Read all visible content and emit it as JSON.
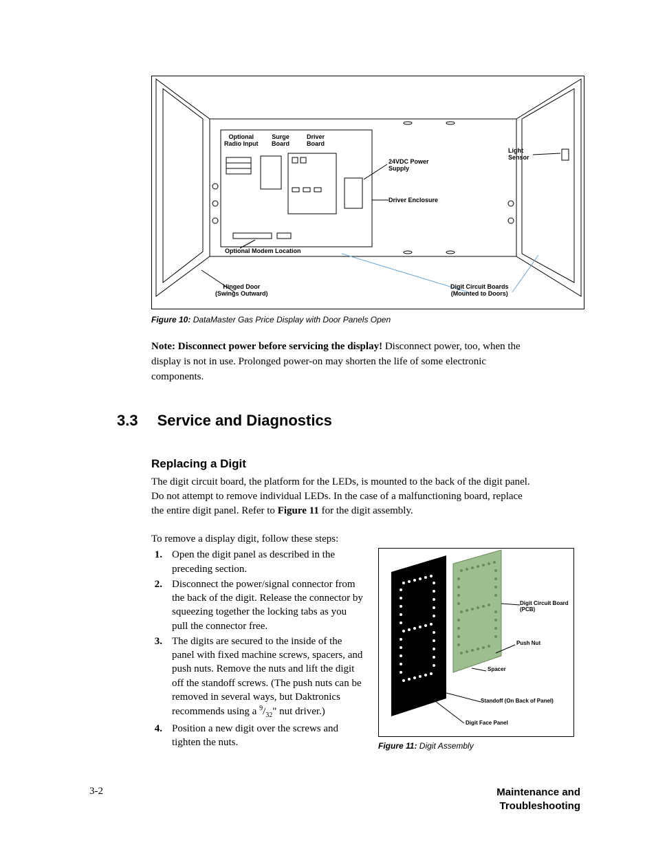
{
  "figure10": {
    "caption_bold": "Figure 10:",
    "caption_text": " DataMaster Gas Price Display with Door Panels Open",
    "labels": {
      "optional_radio_input": "Optional\nRadio Input",
      "surge_board": "Surge\nBoard",
      "driver_board": "Driver\nBoard",
      "power_supply": "24VDC Power\nSupply",
      "driver_enclosure": "Driver Enclosure",
      "light_sensor": "Light\nSensor",
      "optional_modem": "Optional Modem Location",
      "hinged_door": "Hinged Door\n(Swings Outward)",
      "digit_boards": "Digit Circuit Boards\n(Mounted to Doors)"
    }
  },
  "note": {
    "bold": "Note: Disconnect power before servicing the display!",
    "text": " Disconnect power, too, when the display is not in use. Prolonged power-on may shorten the life of some electronic components."
  },
  "section": {
    "number": "3.3",
    "title": "Service and Diagnostics"
  },
  "subsection": {
    "title": "Replacing a Digit",
    "para": "The digit circuit board, the platform for the LEDs, is mounted to the back of the digit panel. Do not attempt to remove individual LEDs. In the case of a malfunctioning board, replace the entire digit panel. Refer to ",
    "para_figref": "Figure 11",
    "para_tail": " for the digit assembly.",
    "intro": "To remove a display digit, follow these steps:"
  },
  "steps": [
    {
      "n": "1.",
      "t": "Open the digit panel as described in the preceding section."
    },
    {
      "n": "2.",
      "t": "Disconnect the power/signal connector from the back of the digit. Release the connector by squeezing together the locking tabs as you pull the connector free."
    },
    {
      "n": "3.",
      "t": "The digits are secured to the inside of the panel with fixed machine screws, spacers, and push nuts. Remove the nuts and lift the digit off the standoff screws. (The push nuts can be removed in several ways, but Daktronics recommends using a ",
      "frac_n": "9",
      "frac_d": "32",
      "tail": "\" nut driver.)"
    },
    {
      "n": "4.",
      "t": "Position a new digit over the screws and tighten the nuts."
    }
  ],
  "figure11": {
    "caption_bold": "Figure 11:",
    "caption_text": " Digit Assembly",
    "labels": {
      "pcb": "Digit Circuit Board (PCB)",
      "push_nut": "Push Nut",
      "spacer": "Spacer",
      "standoff": "Standoff (On Back of Panel)",
      "face_panel": "Digit Face Panel"
    }
  },
  "footer": {
    "page": "3-2",
    "title": "Maintenance and Troubleshooting"
  }
}
